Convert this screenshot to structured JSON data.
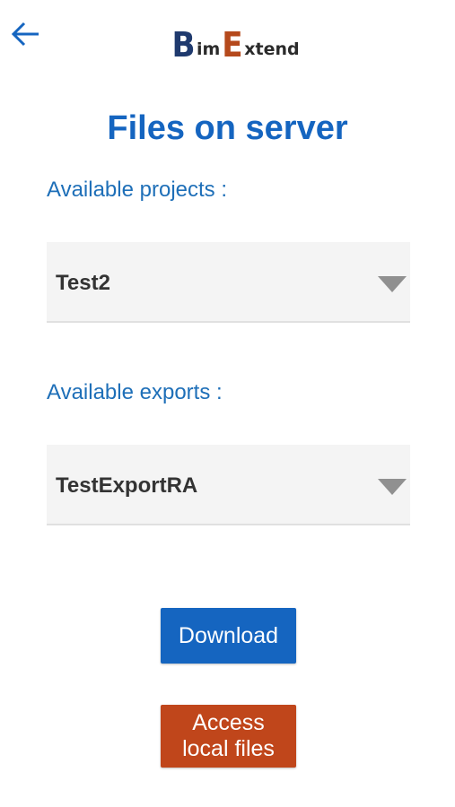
{
  "header": {
    "back_icon": "arrow-left-icon",
    "logo": {
      "first_letter": "B",
      "first_rest": "im",
      "second_letter": "E",
      "second_rest": "xtend"
    }
  },
  "page": {
    "title": "Files on server"
  },
  "projects": {
    "label": "Available projects :",
    "selected": "Test2"
  },
  "exports": {
    "label": "Available exports :",
    "selected": "TestExportRA"
  },
  "actions": {
    "download_label": "Download",
    "local_files_label": "Access\nlocal files"
  },
  "colors": {
    "primary": "#1565c0",
    "accent": "#c0461b",
    "label": "#1e6fb8"
  }
}
